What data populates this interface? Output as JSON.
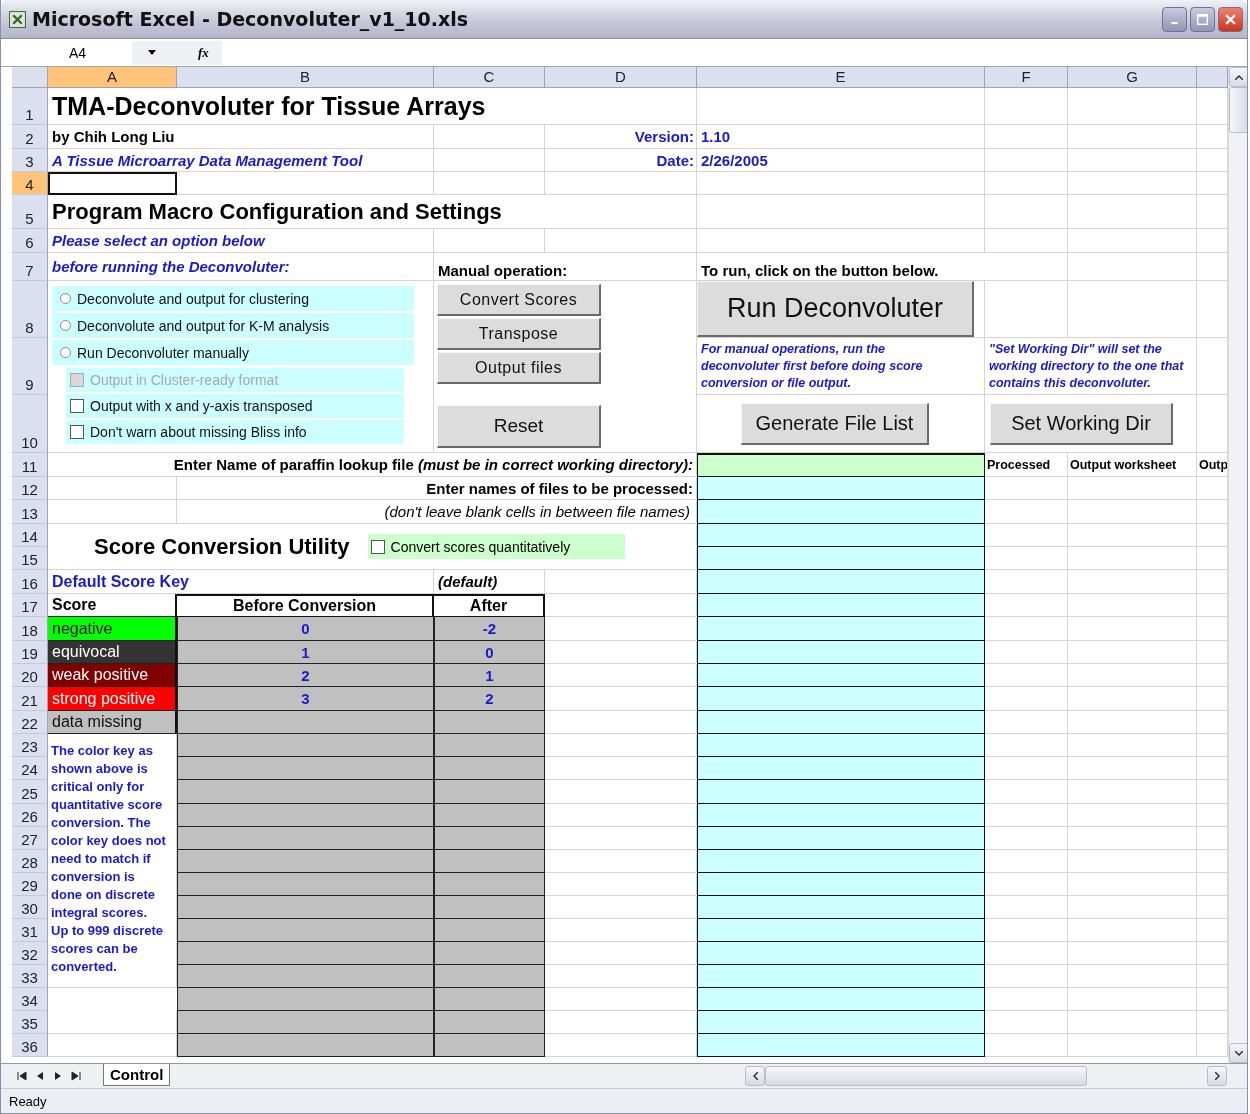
{
  "window": {
    "title": "Microsoft Excel - Deconvoluter_v1_10.xls"
  },
  "formula_bar": {
    "name_box": "A4",
    "function_label": "fx"
  },
  "columns": [
    {
      "label": "A",
      "selected": true
    },
    {
      "label": "B",
      "selected": false
    },
    {
      "label": "C",
      "selected": false
    },
    {
      "label": "D",
      "selected": false
    },
    {
      "label": "E",
      "selected": false
    },
    {
      "label": "F",
      "selected": false
    },
    {
      "label": "G",
      "selected": false
    }
  ],
  "rows": [
    {
      "label": "1",
      "selected": false
    },
    {
      "label": "2",
      "selected": false
    },
    {
      "label": "3",
      "selected": false
    },
    {
      "label": "4",
      "selected": true
    },
    {
      "label": "5",
      "selected": false
    },
    {
      "label": "6",
      "selected": false
    },
    {
      "label": "7",
      "selected": false
    },
    {
      "label": "8",
      "selected": false
    },
    {
      "label": "9",
      "selected": false
    },
    {
      "label": "10",
      "selected": false
    },
    {
      "label": "11",
      "selected": false
    },
    {
      "label": "12",
      "selected": false
    },
    {
      "label": "13",
      "selected": false
    },
    {
      "label": "14",
      "selected": false
    },
    {
      "label": "15",
      "selected": false
    },
    {
      "label": "16",
      "selected": false
    },
    {
      "label": "17",
      "selected": false
    },
    {
      "label": "18",
      "selected": false
    },
    {
      "label": "19",
      "selected": false
    },
    {
      "label": "20",
      "selected": false
    },
    {
      "label": "21",
      "selected": false
    },
    {
      "label": "22",
      "selected": false
    },
    {
      "label": "23",
      "selected": false
    },
    {
      "label": "24",
      "selected": false
    },
    {
      "label": "25",
      "selected": false
    },
    {
      "label": "26",
      "selected": false
    },
    {
      "label": "27",
      "selected": false
    },
    {
      "label": "28",
      "selected": false
    },
    {
      "label": "29",
      "selected": false
    },
    {
      "label": "30",
      "selected": false
    },
    {
      "label": "31",
      "selected": false
    },
    {
      "label": "32",
      "selected": false
    },
    {
      "label": "33",
      "selected": false
    },
    {
      "label": "34",
      "selected": false
    },
    {
      "label": "35",
      "selected": false
    },
    {
      "label": "36",
      "selected": false
    }
  ],
  "header": {
    "title": "TMA-Deconvoluter for Tissue Arrays",
    "author": "by Chih Long Liu",
    "subtitle": "A Tissue Microarray Data Management Tool",
    "version_label": "Version:",
    "version": "1.10",
    "date_label": "Date:",
    "date": "2/26/2005"
  },
  "settings": {
    "heading": "Program Macro Configuration and Settings",
    "instructions": [
      "Please select an option below",
      "before running the Deconvoluter:"
    ],
    "options": [
      {
        "kind": "radio",
        "label": "Deconvolute and output for clustering",
        "checked": false,
        "disabled": false
      },
      {
        "kind": "radio",
        "label": "Deconvolute and output for K-M analysis",
        "checked": false,
        "disabled": false
      },
      {
        "kind": "radio",
        "label": "Run Deconvoluter manually",
        "checked": false,
        "disabled": false
      },
      {
        "kind": "checkbox",
        "label": "Output in Cluster-ready format",
        "checked": false,
        "disabled": true
      },
      {
        "kind": "checkbox",
        "label": "Output with x and y-axis transposed",
        "checked": false,
        "disabled": false
      },
      {
        "kind": "checkbox",
        "label": "Don't warn about missing Bliss info",
        "checked": false,
        "disabled": false
      }
    ],
    "manual_label": "Manual operation:",
    "manual_buttons": [
      "Convert Scores",
      "Transpose",
      "Output files"
    ],
    "reset_button": "Reset",
    "run_label": "To run, click on the button below.",
    "run_button": "Run Deconvoluter",
    "manual_note": "For manual operations, run the deconvoluter first before doing score conversion or file output.",
    "generate_button": "Generate File List",
    "working_dir_note": "\"Set Working Dir\" will set the working directory to the one that contains this deconvoluter.",
    "working_dir_button": "Set Working Dir"
  },
  "files": {
    "lookup_label": "Enter Name of paraffin lookup file *(must be in correct working directory):*",
    "process_label": "Enter names of files to be processed:",
    "process_note": "(don't leave blank cells in between file names)",
    "output_columns": [
      "Processed",
      "Output worksheet",
      "Outp"
    ]
  },
  "score": {
    "heading": "Score Conversion Utility",
    "quantitative": {
      "label": "Convert scores quantitatively",
      "checked": false
    },
    "key_title": "Default Score Key",
    "default_label": "(default)",
    "columns": [
      "Score",
      "Before Conversion",
      "After"
    ],
    "rows": [
      {
        "score": "negative",
        "color": "#00ff00",
        "before": "0",
        "after": "-2"
      },
      {
        "score": "equivocal",
        "color": "#333333",
        "before": "1",
        "after": "0"
      },
      {
        "score": "weak positive",
        "color": "#800000",
        "before": "2",
        "after": "1"
      },
      {
        "score": "strong positive",
        "color": "#ff0000",
        "before": "3",
        "after": "2"
      },
      {
        "score": "data missing",
        "color": "#c0c0c0"
      }
    ],
    "note": "The color key as shown above is critical only for quantitative score conversion.  The color key does not need to match if conversion is done on discrete integral scores. Up to 999 discrete scores can be converted."
  },
  "sheet_tabs": [
    {
      "label": "Control",
      "selected": true
    }
  ],
  "status_bar": "Ready"
}
